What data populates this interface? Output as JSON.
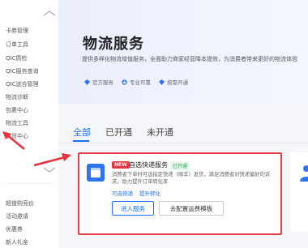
{
  "sidebar": {
    "items": [
      {
        "label": "卡券管理"
      },
      {
        "label": "订单工具"
      },
      {
        "label": "QIC质检"
      },
      {
        "label": "QIC服务查询"
      },
      {
        "label": "QIC送合管理"
      },
      {
        "label": "物流诊断"
      },
      {
        "label": "包裹中心"
      },
      {
        "label": "物流工具"
      },
      {
        "label": "发货中心"
      }
    ],
    "items_bottom": [
      {
        "label": "超值购竞价"
      },
      {
        "label": "活动邀请"
      },
      {
        "label": "优惠券"
      },
      {
        "label": "新人礼金"
      }
    ]
  },
  "header": {
    "title": "物流服务",
    "description": "提供多样化物流增值服务，全面助力商家经营降本提效，为消费者带来更好的物流体验",
    "badges": [
      {
        "icon": "diamond-icon",
        "label": "官方服务"
      },
      {
        "icon": "star-icon",
        "label": "专业可靠"
      },
      {
        "icon": "diamond-icon",
        "label": "按需开通"
      }
    ]
  },
  "tabs": [
    {
      "label": "全部",
      "active": true
    },
    {
      "label": "已开通",
      "active": false
    },
    {
      "label": "未开通",
      "active": false
    }
  ],
  "service_card": {
    "new_tag": "NEW",
    "name": "自选快递服务",
    "status": "已开通",
    "description": "消费者下单时可选指定快递（顺丰）发货，满足消费者对快递偏好的诉求，助力提升订单转化率",
    "links": [
      "可选快递",
      "提升转化"
    ],
    "primary_button": "进入服务",
    "secondary_button": "去配置运费模板"
  },
  "colors": {
    "accent": "#1d6ff2",
    "highlight": "#e2404a",
    "status_green": "#2aa84f"
  }
}
